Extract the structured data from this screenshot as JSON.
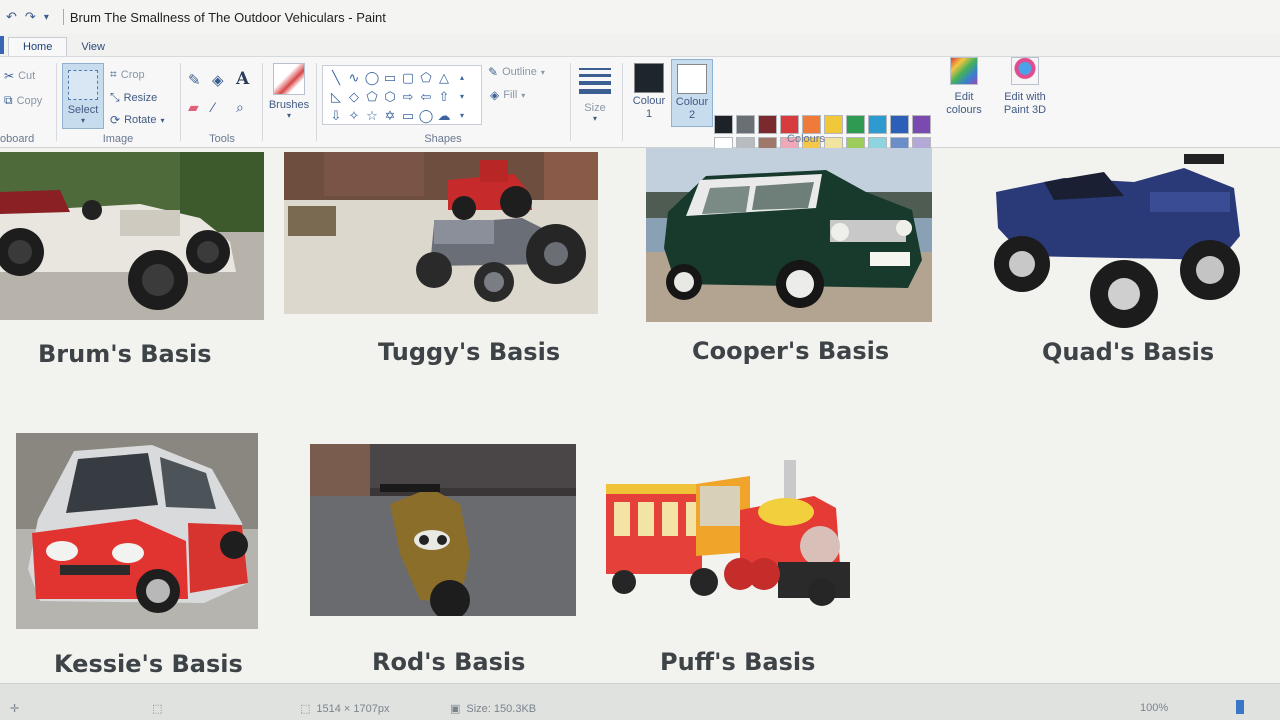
{
  "window": {
    "title": "Brum The Smallness of The Outdoor Vehiculars - Paint"
  },
  "tabs": [
    {
      "label": "Home",
      "active": true
    },
    {
      "label": "View",
      "active": false
    }
  ],
  "ribbon": {
    "clipboard": {
      "cut": "Cut",
      "copy": "Copy",
      "group_label": "oboard"
    },
    "image": {
      "select": "Select",
      "crop": "Crop",
      "resize": "Resize",
      "rotate": "Rotate",
      "group_label": "Image"
    },
    "tools": {
      "group_label": "Tools",
      "text_glyph": "A"
    },
    "brushes": {
      "label": "Brushes"
    },
    "shapes": {
      "group_label": "Shapes",
      "outline": "Outline",
      "fill": "Fill"
    },
    "size": {
      "label": "Size"
    },
    "colours": {
      "colour1_label": "Colour 1",
      "colour2_label": "Colour 2",
      "colour1": "#1f252c",
      "colour2": "#ffffff",
      "edit_colours": "Edit colours",
      "edit_3d": "Edit with Paint 3D",
      "group_label": "Colours",
      "palette": [
        "#1c2228",
        "#6a6f75",
        "#7a2a2e",
        "#d83b3e",
        "#ef7a3a",
        "#f0c83a",
        "#2f9a52",
        "#2d9bd0",
        "#2c5fb8",
        "#7b4ab0",
        "#ffffff",
        "#b8bcc0",
        "#a0786a",
        "#f0a8b8",
        "#f4c64a",
        "#f0e4a0",
        "#9ccc5a",
        "#8ed4e0",
        "#6c8ec8",
        "#b4a8d8",
        "#23324a",
        "#ffffff",
        "#ffffff",
        "#ffffff",
        "#ffffff",
        "#ffffff",
        "#ffffff",
        "#ffffff",
        "#ffffff",
        "#ffffff"
      ]
    }
  },
  "canvas": {
    "captions": {
      "brum": "Brum's Basis",
      "tuggy": "Tuggy's Basis",
      "cooper": "Cooper's Basis",
      "quad": "Quad's Basis",
      "kessie": "Kessie's Basis",
      "rod": "Rod's Basis",
      "puff": "Puff's Basis"
    }
  },
  "statusbar": {
    "dimensions": "1514 × 1707px",
    "size": "Size: 150.3KB",
    "zoom": "100%"
  }
}
